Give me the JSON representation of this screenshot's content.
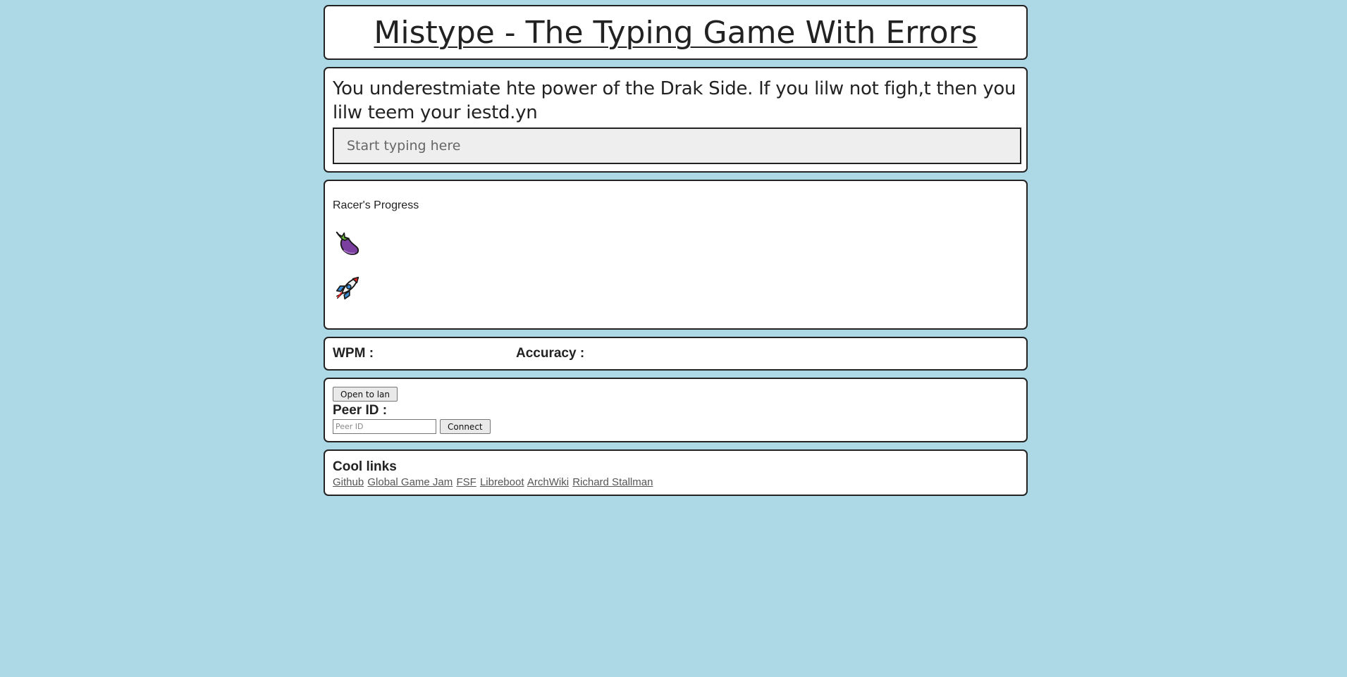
{
  "header": {
    "title": "Mistype - The Typing Game With Errors"
  },
  "typing": {
    "prompt": "You underestmiate hte power of the Drak Side. If you lilw not figh,t then you lilw teem your iestd.yn",
    "input_placeholder": "Start typing here",
    "input_value": ""
  },
  "progress": {
    "title": "Racer's Progress",
    "racers": [
      {
        "icon": "eggplant-icon",
        "progress": 0
      },
      {
        "icon": "rocket-icon",
        "progress": 0
      }
    ]
  },
  "stats": {
    "wpm_label": "WPM :",
    "wpm_value": "",
    "accuracy_label": "Accuracy :",
    "accuracy_value": ""
  },
  "network": {
    "open_button": "Open to lan",
    "peer_label": "Peer ID :",
    "peer_placeholder": "Peer ID",
    "connect_button": "Connect"
  },
  "links": {
    "title": "Cool links",
    "items": [
      "Github",
      "Global Game Jam",
      "FSF",
      "Libreboot",
      "ArchWiki",
      "Richard Stallman"
    ]
  },
  "colors": {
    "background": "#add8e6",
    "panel": "#ffffff",
    "border": "#222222",
    "input_bg": "#eeeeee"
  }
}
